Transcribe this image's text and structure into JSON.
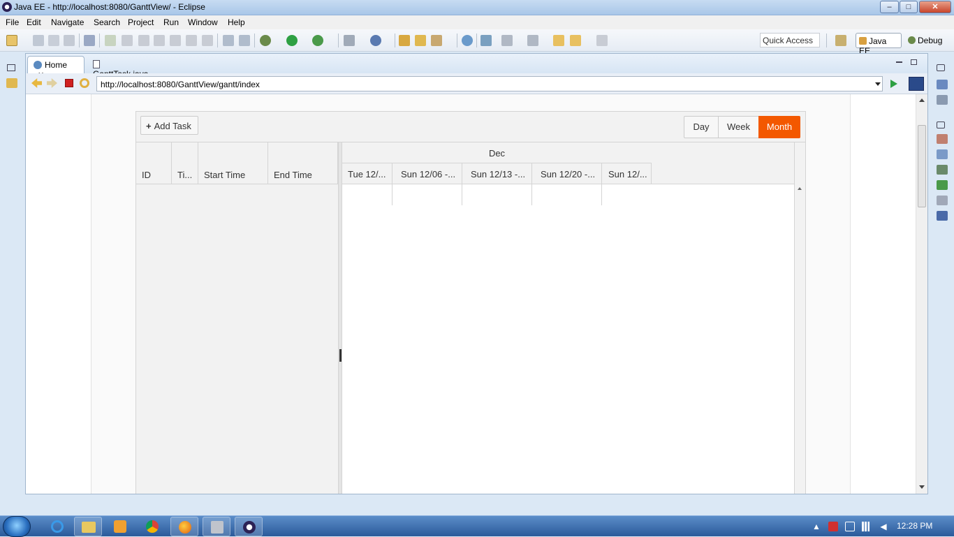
{
  "window": {
    "title": "Java EE - http://localhost:8080/GanttView/ - Eclipse",
    "min": "–",
    "max": "□",
    "close": "✕"
  },
  "menu": [
    "File",
    "Edit",
    "Navigate",
    "Search",
    "Project",
    "Run",
    "Window",
    "Help"
  ],
  "toolbar": {
    "quick_access": "Quick Access",
    "perspectives": [
      "Java EE",
      "Debug"
    ]
  },
  "tabs": [
    {
      "label": "Home",
      "close": "✕"
    },
    {
      "label": "GanttTask.java"
    }
  ],
  "browser": {
    "url": "http://localhost:8080/GanttView/gantt/index"
  },
  "gantt": {
    "add_task": "Add Task",
    "views": [
      "Day",
      "Week",
      "Month"
    ],
    "selected_view": "Month",
    "columns": [
      "ID",
      "Ti...",
      "Start Time",
      "End Time"
    ],
    "month": "Dec",
    "timeline_columns": [
      "Tue 12/...",
      "Sun 12/06 -...",
      "Sun 12/13 -...",
      "Sun 12/20 -...",
      "Sun 12/..."
    ]
  },
  "taskbar": {
    "clock": "12:28 PM"
  },
  "colors": {
    "accent": "#f35800",
    "title_bar": "#b9d1ea"
  }
}
